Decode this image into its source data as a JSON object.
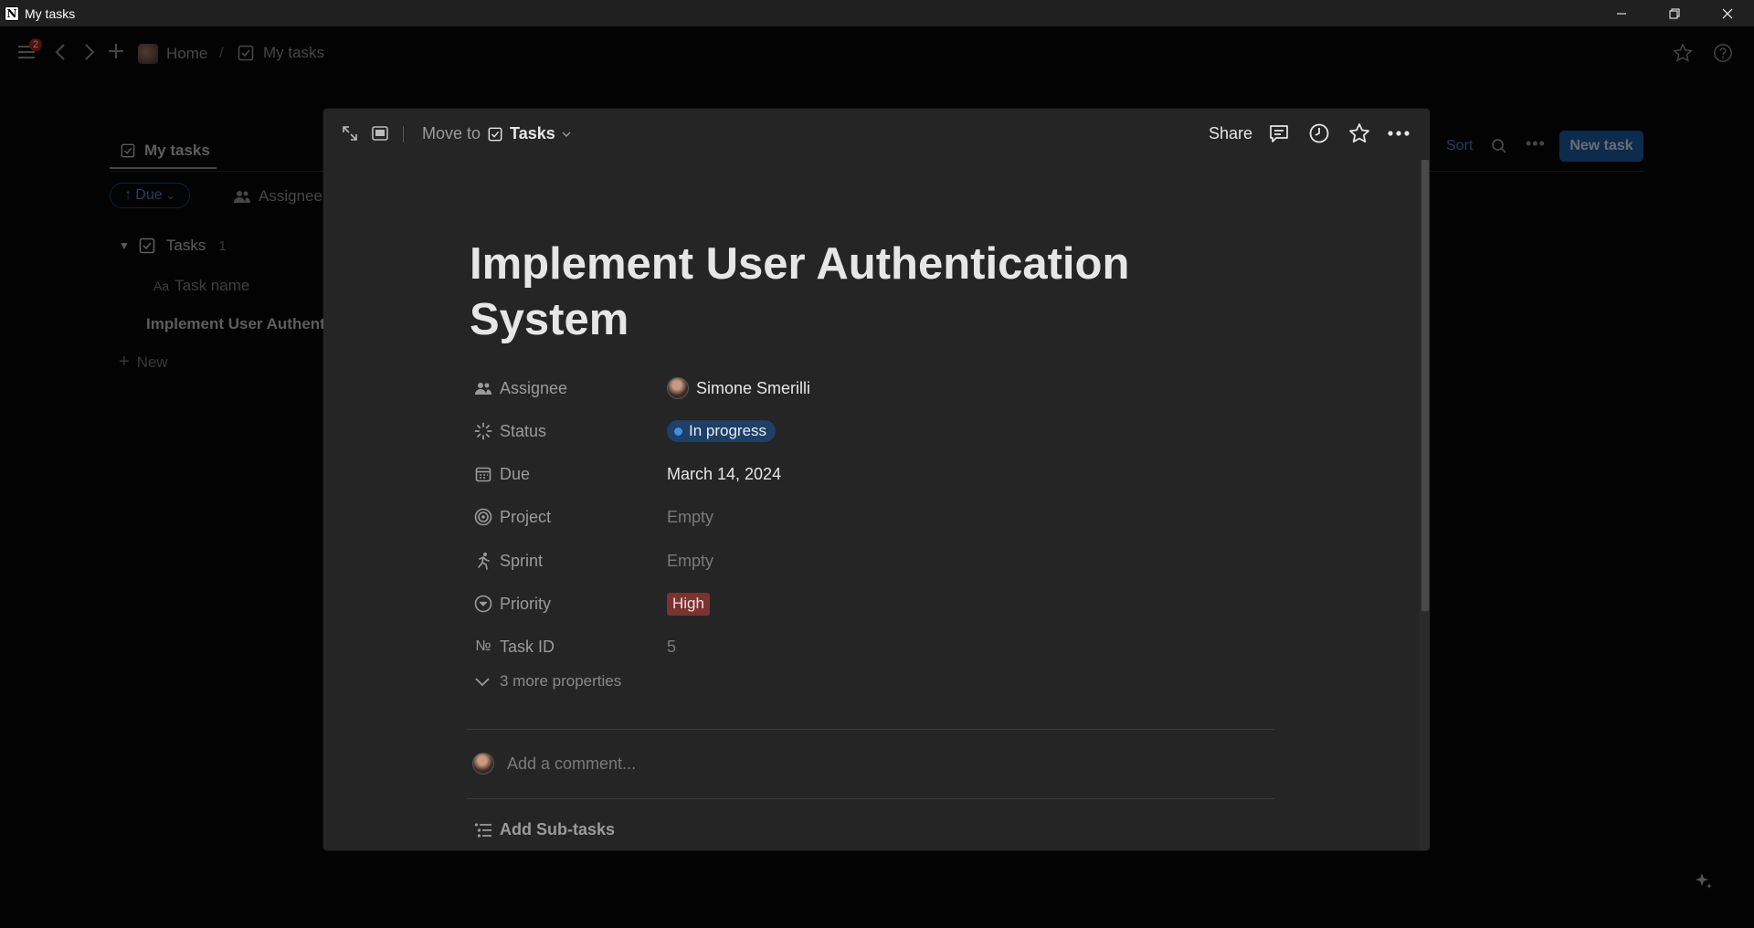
{
  "window": {
    "title": "My tasks",
    "logo_glyph": "N"
  },
  "topnav": {
    "notification_count": "2",
    "breadcrumb": [
      {
        "label": "Home",
        "icon": "home-avatar"
      },
      {
        "label": "My tasks",
        "icon": "checkbox-icon"
      }
    ],
    "separator": "/"
  },
  "background_page": {
    "view_tab": "My tasks",
    "sort_chip": "Due",
    "filter_chip": "Assignee",
    "group_label": "Tasks",
    "group_count": "1",
    "column_header": "Task name",
    "column_icon_text": "Aa",
    "row_title": "Implement User Authentication System",
    "new_label": "New",
    "sort_label": "Sort",
    "new_task_button": "New task"
  },
  "modal": {
    "move_to_label": "Move to",
    "move_to_target": "Tasks",
    "share_label": "Share",
    "title_line1": "Implement User Authentication",
    "title_line2": "System",
    "properties": [
      {
        "name": "Assignee",
        "icon": "people-icon",
        "value": "Simone Smerilli"
      },
      {
        "name": "Status",
        "icon": "status-spinner-icon",
        "value": "In progress"
      },
      {
        "name": "Due",
        "icon": "calendar-icon",
        "value": "March 14, 2024"
      },
      {
        "name": "Project",
        "icon": "target-icon",
        "value": "Empty"
      },
      {
        "name": "Sprint",
        "icon": "runner-icon",
        "value": "Empty"
      },
      {
        "name": "Priority",
        "icon": "chevron-circle-icon",
        "value": "High"
      },
      {
        "name": "Task ID",
        "icon": "numero-icon",
        "value": "5"
      }
    ],
    "more_properties": "3 more properties",
    "comment_placeholder": "Add a comment...",
    "add_subtasks": "Add Sub-tasks"
  },
  "colors": {
    "status_blue": "#1f3f66",
    "priority_red": "#7a3330",
    "accent_blue": "#1e5fa8"
  }
}
